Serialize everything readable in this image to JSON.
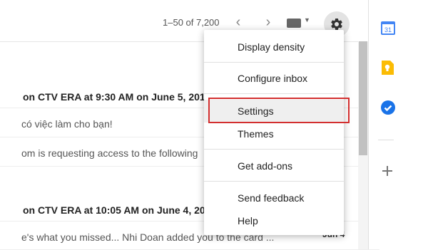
{
  "toolbar": {
    "pager_text": "1–50 of 7,200",
    "prev_icon": "chevron-left-icon",
    "next_icon": "chevron-right-icon",
    "keyboard_icon": "keyboard-icon",
    "settings_icon": "gear-icon"
  },
  "mails": [
    {
      "subject": "on CTV ERA at 9:30 AM on June 5, 201"
    },
    {
      "snippet": "có việc làm cho bạn!"
    },
    {
      "snippet": "om is requesting access to the following"
    },
    {
      "subject": "on CTV ERA at 10:05 AM on June 4, 201"
    },
    {
      "snippet": "e's what you missed... Nhi Doan added you to the card ...",
      "date": "Jun 4"
    }
  ],
  "settings_menu": {
    "items": [
      {
        "label": "Display density"
      },
      {
        "label": "Configure inbox"
      },
      {
        "label": "Settings",
        "highlighted": true
      },
      {
        "label": "Themes"
      },
      {
        "label": "Get add-ons"
      },
      {
        "label": "Send feedback"
      },
      {
        "label": "Help"
      }
    ]
  },
  "side_panel": {
    "calendar_icon": "calendar-icon",
    "calendar_day": "31",
    "keep_icon": "keep-icon",
    "tasks_icon": "tasks-icon",
    "add_icon": "plus-icon"
  },
  "colors": {
    "highlight_border": "#d32f2f",
    "calendar_blue": "#4285f4",
    "keep_yellow": "#fbbc04",
    "tasks_blue": "#1a73e8"
  }
}
